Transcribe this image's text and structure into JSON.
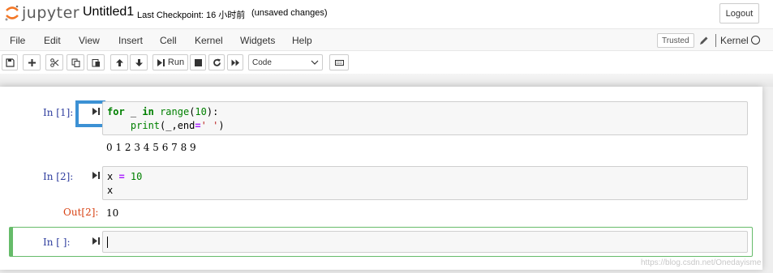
{
  "header": {
    "logo_text": "jupyter",
    "notebook_title": "Untitled1",
    "checkpoint": "Last Checkpoint: 16 小时前",
    "autosave_status": "(unsaved changes)",
    "logout_label": "Logout"
  },
  "menubar": {
    "items": [
      "File",
      "Edit",
      "View",
      "Insert",
      "Cell",
      "Kernel",
      "Widgets",
      "Help"
    ],
    "trusted_label": "Trusted",
    "kernel_name": "Kernel"
  },
  "toolbar": {
    "run_label": "Run",
    "cell_type": "Code"
  },
  "cells": [
    {
      "prompt": "In [1]:",
      "code_lines": [
        [
          {
            "t": "for",
            "c": "kw"
          },
          {
            "t": " _ ",
            "c": ""
          },
          {
            "t": "in",
            "c": "kw"
          },
          {
            "t": " ",
            "c": ""
          },
          {
            "t": "range",
            "c": "bi"
          },
          {
            "t": "(",
            "c": ""
          },
          {
            "t": "10",
            "c": "num"
          },
          {
            "t": "):",
            "c": ""
          }
        ],
        [
          {
            "t": "    ",
            "c": ""
          },
          {
            "t": "print",
            "c": "bi"
          },
          {
            "t": "(_,end",
            "c": ""
          },
          {
            "t": "=",
            "c": "op"
          },
          {
            "t": "' '",
            "c": "str"
          },
          {
            "t": ")",
            "c": ""
          }
        ]
      ],
      "output": "0 1 2 3 4 5 6 7 8 9"
    },
    {
      "prompt": "In [2]:",
      "code_lines": [
        [
          {
            "t": "x ",
            "c": ""
          },
          {
            "t": "=",
            "c": "op"
          },
          {
            "t": " ",
            "c": ""
          },
          {
            "t": "10",
            "c": "num"
          }
        ],
        [
          {
            "t": "x",
            "c": ""
          }
        ]
      ],
      "out_prompt": "Out[2]:",
      "output": "10"
    },
    {
      "prompt": "In [ ]:"
    }
  ],
  "watermark": "https://blog.csdn.net/Onedayisme",
  "colors": {
    "prompt_in": "#303f9f",
    "prompt_out": "#d84315",
    "active_cell_border": "#66bb6a",
    "highlight_box": "#3c91d4"
  }
}
